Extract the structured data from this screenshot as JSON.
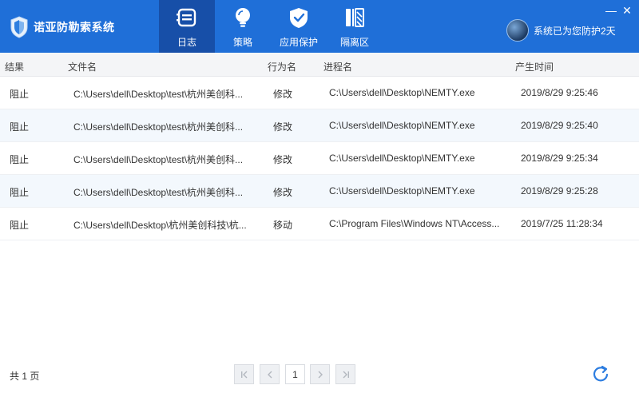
{
  "app": {
    "title": "诺亚防勒索系统"
  },
  "nav": {
    "tabs": [
      {
        "label": "日志",
        "icon": "log-icon",
        "active": true
      },
      {
        "label": "策略",
        "icon": "lightbulb-icon",
        "active": false
      },
      {
        "label": "应用保护",
        "icon": "shield-check-icon",
        "active": false
      },
      {
        "label": "隔离区",
        "icon": "quarantine-icon",
        "active": false
      }
    ]
  },
  "status": {
    "text": "系统已为您防护2天"
  },
  "window": {
    "minimize": "—",
    "close": "✕"
  },
  "table": {
    "headers": [
      "结果",
      "文件名",
      "行为名",
      "进程名",
      "产生时间"
    ],
    "rows": [
      {
        "result": "阻止",
        "file": "C:\\Users\\dell\\Desktop\\test\\杭州美创科...",
        "action": "修改",
        "process": "C:\\Users\\dell\\Desktop\\NEMTY.exe",
        "time": "2019/8/29 9:25:46"
      },
      {
        "result": "阻止",
        "file": "C:\\Users\\dell\\Desktop\\test\\杭州美创科...",
        "action": "修改",
        "process": "C:\\Users\\dell\\Desktop\\NEMTY.exe",
        "time": "2019/8/29 9:25:40"
      },
      {
        "result": "阻止",
        "file": "C:\\Users\\dell\\Desktop\\test\\杭州美创科...",
        "action": "修改",
        "process": "C:\\Users\\dell\\Desktop\\NEMTY.exe",
        "time": "2019/8/29 9:25:34"
      },
      {
        "result": "阻止",
        "file": "C:\\Users\\dell\\Desktop\\test\\杭州美创科...",
        "action": "修改",
        "process": "C:\\Users\\dell\\Desktop\\NEMTY.exe",
        "time": "2019/8/29 9:25:28"
      },
      {
        "result": "阻止",
        "file": "C:\\Users\\dell\\Desktop\\杭州美创科技\\杭...",
        "action": "移动",
        "process": "C:\\Program Files\\Windows NT\\Access...",
        "time": "2019/7/25 11:28:34"
      }
    ]
  },
  "footer": {
    "total": "共 1 页",
    "current_page": "1"
  },
  "colors": {
    "header_blue": "#1f6fd8",
    "active_tab": "#174fa8",
    "row_stripe": "#f3f8fd"
  }
}
